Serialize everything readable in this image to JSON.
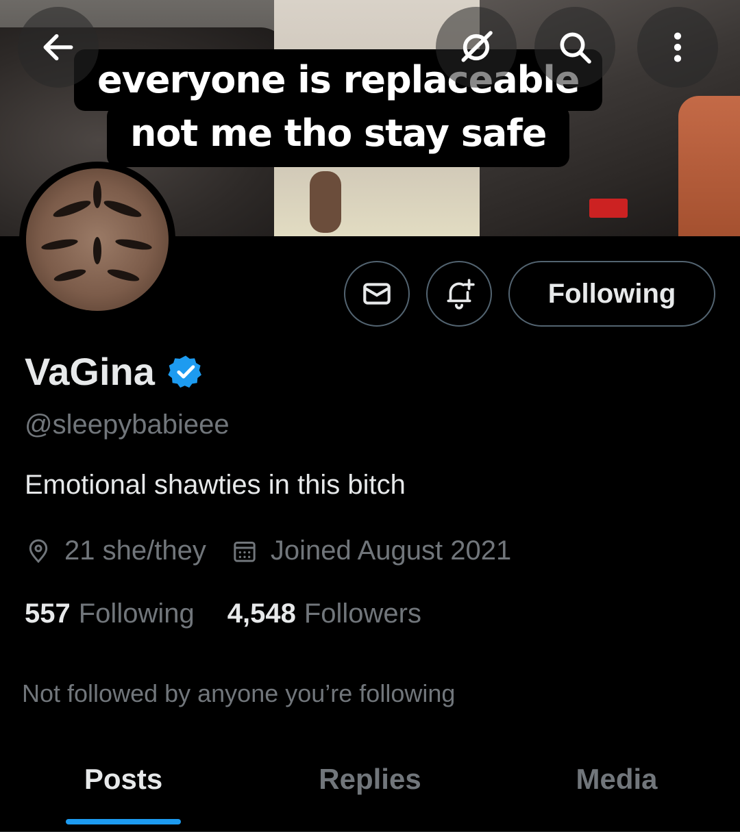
{
  "banner": {
    "caption_line1": "everyone is replaceable",
    "caption_line2": "not me tho stay safe"
  },
  "top_bar": {
    "back_icon": "arrow-left-icon",
    "grok_icon": "grok-icon",
    "search_icon": "search-icon",
    "more_icon": "more-vertical-icon"
  },
  "actions": {
    "message_icon": "envelope-icon",
    "notify_icon": "bell-plus-icon",
    "follow_label": "Following"
  },
  "profile": {
    "display_name": "VaGina",
    "handle": "@sleepybabieee",
    "bio": "Emotional shawties in this bitch",
    "location": "21 she/they",
    "joined": "Joined August 2021",
    "following_count": "557",
    "following_label": "Following",
    "followers_count": "4,548",
    "followers_label": "Followers",
    "mutuals_note": "Not followed by anyone you’re following"
  },
  "tabs": [
    {
      "label": "Posts",
      "active": true
    },
    {
      "label": "Replies",
      "active": false
    },
    {
      "label": "Media",
      "active": false
    }
  ],
  "colors": {
    "background": "#000000",
    "accent": "#1d9bf0",
    "text_primary": "#e7e9ea",
    "text_secondary": "#71767b",
    "border": "#536471"
  }
}
